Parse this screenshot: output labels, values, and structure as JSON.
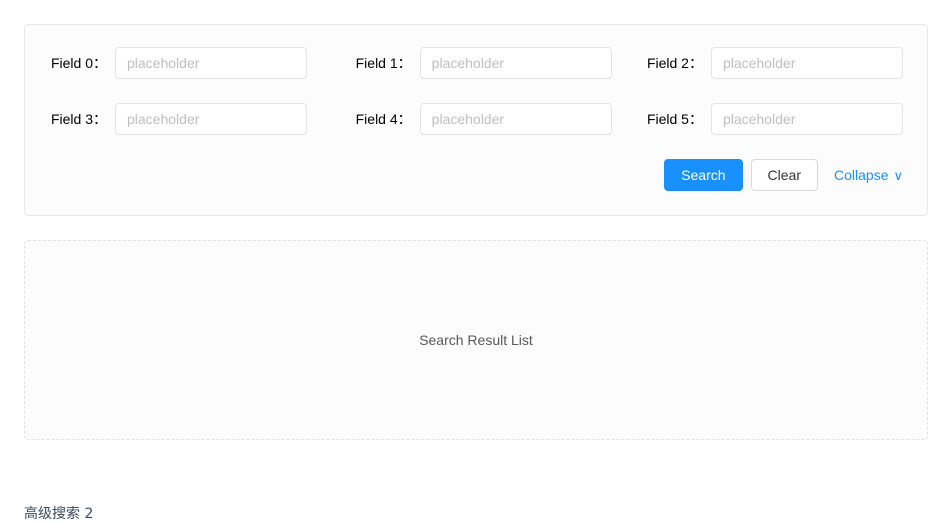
{
  "page": {
    "background": "#ffffff",
    "accent_color": "#1890ff"
  },
  "search_form": {
    "fields": [
      {
        "label": "Field 0：",
        "value": "",
        "placeholder": "placeholder"
      },
      {
        "label": "Field 1：",
        "value": "",
        "placeholder": "placeholder"
      },
      {
        "label": "Field 2：",
        "value": "",
        "placeholder": "placeholder"
      },
      {
        "label": "Field 3：",
        "value": "",
        "placeholder": "placeholder"
      },
      {
        "label": "Field 4：",
        "value": "",
        "placeholder": "placeholder"
      },
      {
        "label": "Field 5：",
        "value": "",
        "placeholder": "placeholder"
      }
    ],
    "actions": {
      "search_label": "Search",
      "clear_label": "Clear",
      "collapse_label": "Collapse",
      "collapse_icon": "chevron-down-icon",
      "collapse_glyph": "∨"
    }
  },
  "result_panel": {
    "placeholder_text": "Search Result List"
  },
  "bottom_caption": {
    "text": "高级搜索 2"
  }
}
